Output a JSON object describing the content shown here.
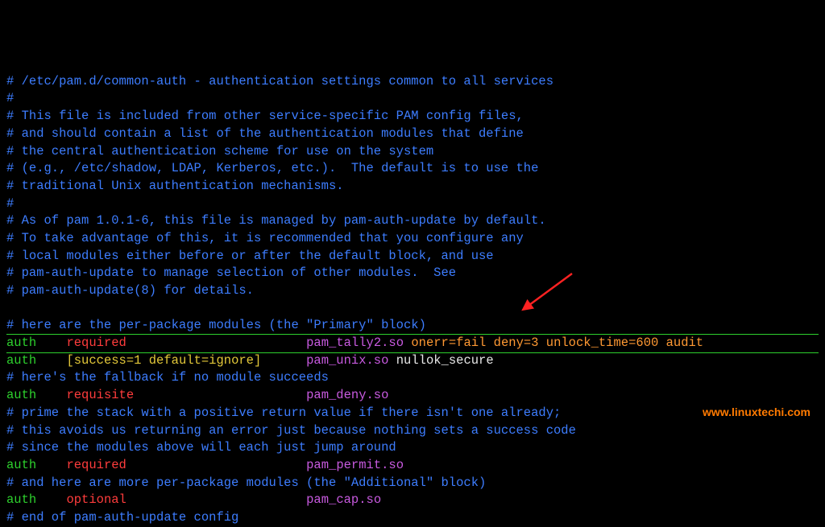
{
  "comments": {
    "c00": "# /etc/pam.d/common-auth - authentication settings common to all services",
    "c01": "#",
    "c02": "# This file is included from other service-specific PAM config files,",
    "c03": "# and should contain a list of the authentication modules that define",
    "c04": "# the central authentication scheme for use on the system",
    "c05": "# (e.g., /etc/shadow, LDAP, Kerberos, etc.).  The default is to use the",
    "c06": "# traditional Unix authentication mechanisms.",
    "c07": "#",
    "c08": "# As of pam 1.0.1-6, this file is managed by pam-auth-update by default.",
    "c09": "# To take advantage of this, it is recommended that you configure any",
    "c10": "# local modules either before or after the default block, and use",
    "c11": "# pam-auth-update to manage selection of other modules.  See",
    "c12": "# pam-auth-update(8) for details.",
    "c13": "",
    "c14": "# here are the per-package modules (the \"Primary\" block)",
    "c15": "# here's the fallback if no module succeeds",
    "c16": "# prime the stack with a positive return value if there isn't one already;",
    "c17": "# this avoids us returning an error just because nothing sets a success code",
    "c18": "# since the modules above will each just jump around",
    "c19": "# and here are more per-package modules (the \"Additional\" block)",
    "c20": "# end of pam-auth-update config"
  },
  "lines": {
    "l1": {
      "type": "auth",
      "ctrl": "required",
      "module": "pam_tally2.so",
      "args": "onerr=fail deny=3 unlock_time=600 audit"
    },
    "l2": {
      "type": "auth",
      "ctrl": "[success=1 default=ignore]",
      "module": "pam_unix.so",
      "args": "nullok_secure"
    },
    "l3": {
      "type": "auth",
      "ctrl": "requisite",
      "module": "pam_deny.so",
      "args": ""
    },
    "l4": {
      "type": "auth",
      "ctrl": "required",
      "module": "pam_permit.so",
      "args": ""
    },
    "l5": {
      "type": "auth",
      "ctrl": "optional",
      "module": "pam_cap.so",
      "args": ""
    }
  },
  "watermark": "www.linuxtechi.com",
  "colors": {
    "comment": "#3d7dff",
    "type": "#2dd02d",
    "ctrl_word": "#ff3c3c",
    "ctrl_bracket": "#e3c839",
    "module": "#c85ae0",
    "args_orange": "#ff9933",
    "args_white": "#e8e8e8"
  }
}
